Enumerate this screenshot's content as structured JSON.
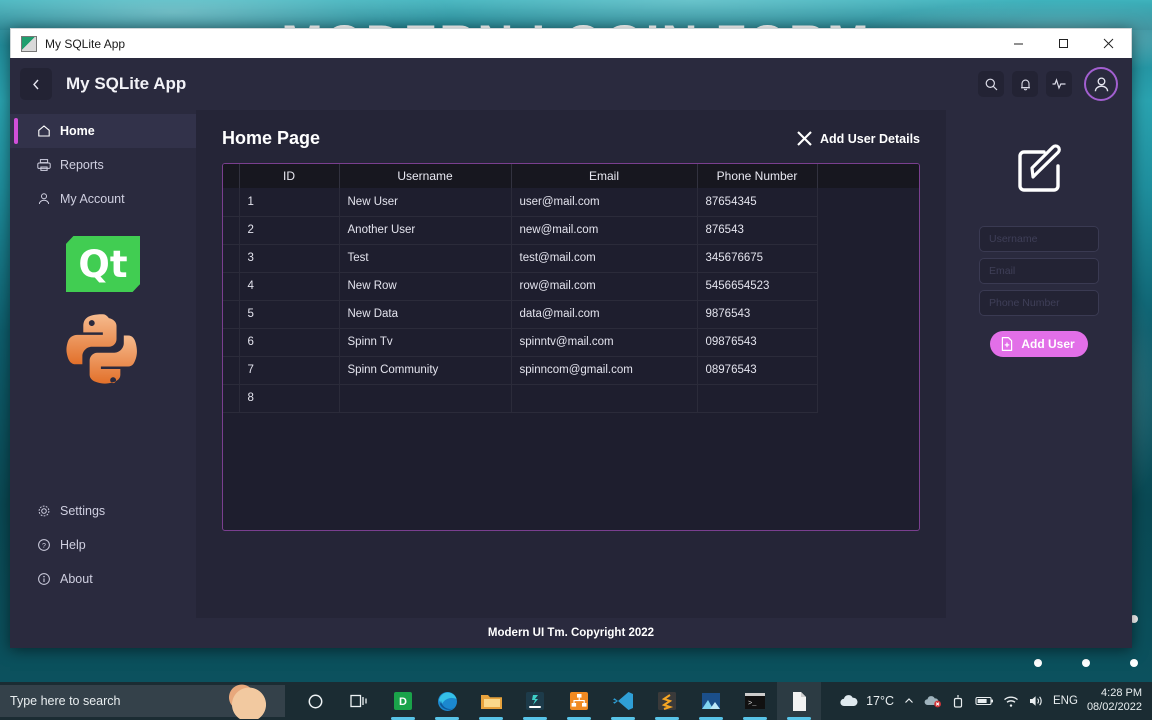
{
  "desktop": {
    "watermark_text": "MODERN LOGIN FORM"
  },
  "window": {
    "titlebar": {
      "title": "My SQLite App",
      "icon": "app-icon",
      "minimize_label": "–",
      "maximize_label": "☐",
      "close_label": "✕"
    },
    "header": {
      "back_label": "‹",
      "app_title": "My SQLite App",
      "icons": [
        {
          "name": "search-icon",
          "label": ""
        },
        {
          "name": "bell-icon",
          "label": ""
        },
        {
          "name": "activity-icon",
          "label": ""
        }
      ],
      "avatar_name": "user-avatar"
    },
    "sidebar": {
      "top_items": [
        {
          "label": "Home",
          "icon": "home-icon",
          "active": true
        },
        {
          "label": "Reports",
          "icon": "printer-icon",
          "active": false
        },
        {
          "label": "My Account",
          "icon": "person-icon",
          "active": false
        }
      ],
      "logos": [
        {
          "name": "qt-logo",
          "text": "Qt"
        },
        {
          "name": "python-logo",
          "text": ""
        }
      ],
      "bottom_items": [
        {
          "label": "Settings",
          "icon": "gear-icon"
        },
        {
          "label": "Help",
          "icon": "question-circle-icon"
        },
        {
          "label": "About",
          "icon": "info-circle-icon"
        }
      ]
    },
    "content": {
      "page_title": "Home Page",
      "add_user_details_label": "Add User Details",
      "add_user_details_icon": "x-icon",
      "table": {
        "columns": [
          "ID",
          "Username",
          "Email",
          "Phone Number"
        ],
        "rows": [
          {
            "id": "1",
            "username": "New User",
            "email": "user@mail.com",
            "phone": "87654345"
          },
          {
            "id": "2",
            "username": "Another User",
            "email": "new@mail.com",
            "phone": "876543"
          },
          {
            "id": "3",
            "username": "Test",
            "email": "test@mail.com",
            "phone": "345676675"
          },
          {
            "id": "4",
            "username": "New Row",
            "email": "row@mail.com",
            "phone": "5456654523"
          },
          {
            "id": "5",
            "username": "New Data",
            "email": "data@mail.com",
            "phone": "9876543"
          },
          {
            "id": "6",
            "username": "Spinn Tv",
            "email": "spinntv@mail.com",
            "phone": "09876543"
          },
          {
            "id": "7",
            "username": "Spinn Community",
            "email": "spinncom@gmail.com",
            "phone": "08976543"
          },
          {
            "id": "8",
            "username": "",
            "email": "",
            "phone": ""
          }
        ]
      }
    },
    "form_panel": {
      "edit_icon": "edit-square-icon",
      "fields": [
        {
          "name": "username-field",
          "placeholder": "Username",
          "value": ""
        },
        {
          "name": "email-field",
          "placeholder": "Email",
          "value": ""
        },
        {
          "name": "phone-field",
          "placeholder": "Phone Number",
          "value": ""
        }
      ],
      "submit_label": "Add User",
      "submit_icon": "file-plus-icon",
      "accent_color": "#e26fe8"
    },
    "footer": {
      "text": "Modern UI Tm. Copyright 2022"
    }
  },
  "taskbar": {
    "search_placeholder": "Type here to search",
    "start_icon": "start-icon",
    "task_view_icon": "task-view-icon",
    "apps": [
      {
        "name": "cortana-icon",
        "label": ""
      },
      {
        "name": "start-circle-icon",
        "label": ""
      },
      {
        "name": "task-view-icon",
        "label": ""
      },
      {
        "name": "dbeaver-icon",
        "label": "D"
      },
      {
        "name": "edge-icon",
        "label": ""
      },
      {
        "name": "file-explorer-icon",
        "label": ""
      },
      {
        "name": "microscope-icon",
        "label": ""
      },
      {
        "name": "orange-network-icon",
        "label": ""
      },
      {
        "name": "vscode-icon",
        "label": ""
      },
      {
        "name": "sublime-icon",
        "label": ""
      },
      {
        "name": "photos-icon",
        "label": ""
      },
      {
        "name": "terminal-icon",
        "label": ""
      },
      {
        "name": "document-icon",
        "label": ""
      }
    ],
    "tray": {
      "weather_temp": "17°C",
      "weather_icon": "cloud-icon",
      "chevron_icon": "chevron-up-icon",
      "onedrive_icon": "onedrive-error-icon",
      "meet_icon": "meet-icon",
      "battery_icon": "battery-icon",
      "wifi_icon": "wifi-icon",
      "volume_icon": "volume-icon",
      "language": "ENG",
      "time": "4:28 PM",
      "date": "08/02/2022"
    }
  }
}
